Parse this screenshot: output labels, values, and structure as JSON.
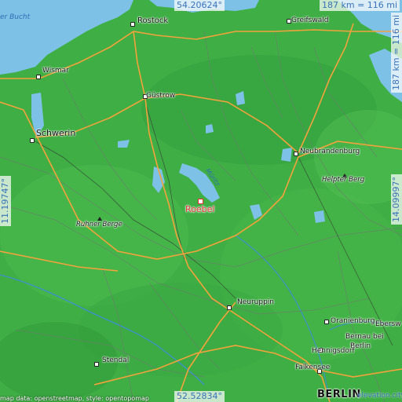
{
  "coordinates": {
    "top_lat": "54.20624°",
    "bottom_lat": "52.52834°",
    "left_lon": "11.19747°",
    "right_lon": "14.09997°"
  },
  "scale": {
    "horizontal": "187 km = 116 mi",
    "vertical": "187 km = 116 mi"
  },
  "places": {
    "rostock": "Rostock",
    "wismar": "Wismar",
    "greifswald": "Greifswald",
    "guestrow": "Güstrow",
    "schwerin": "Schwerin",
    "neubrandenburg": "Neubrandenburg",
    "helpter_berg": "Helpter Berg",
    "roebel": "Roebel",
    "ruhner_berge": "Ruhner Berge",
    "neuruppin": "Neuruppin",
    "oranienburg": "Oranienburg",
    "eberswalde": "Ebersw",
    "bernau": "Bernau bei",
    "berlin_small": "Berlin",
    "hennigsdorf": "Hennigsdorf",
    "stendal": "Stendal",
    "falkensee": "Falkensee",
    "berlin": "BERLIN",
    "elevation_city": "elevation.city",
    "wismar_bucht": "er Bucht",
    "mueritz": "Müritz"
  },
  "attribution": "map data: openstreetmap, style: opentopomap",
  "colors": {
    "land": "#3fae45",
    "sea": "#7ec1e6",
    "road": "#f3a23c",
    "target": "#e03030",
    "coord_text": "#3a72b8"
  }
}
